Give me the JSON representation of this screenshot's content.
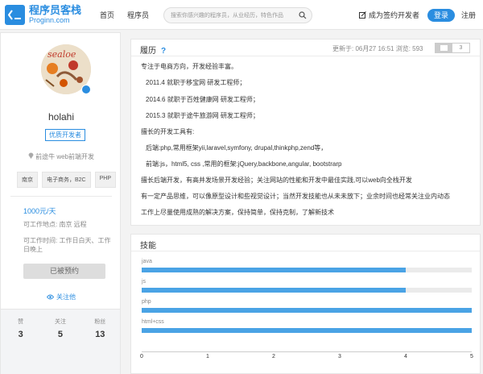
{
  "header": {
    "brand_name": "程序员客栈",
    "brand_domain": "Proginn.com",
    "nav": [
      "首页",
      "程序员"
    ],
    "search_placeholder": "搜索你感兴趣的程序员，从业经历，特色作品",
    "hire_label": "成为签约开发者",
    "login_label": "登录",
    "register_label": "注册"
  },
  "profile": {
    "username": "holahi",
    "badge": "优质开发者",
    "position": "前途牛 web前端开发",
    "tags": [
      "南京",
      "电子商务，B2C",
      "PHP"
    ],
    "price": "1000元/天",
    "location": "可工作地点: 南京 远程",
    "work_time": "可工作时间: 工作日白天、工作日晚上",
    "booked_label": "已被预约",
    "follow_label": "关注他",
    "stats": [
      {
        "label": "赞",
        "value": "3"
      },
      {
        "label": "关注",
        "value": "5"
      },
      {
        "label": "粉丝",
        "value": "13"
      }
    ]
  },
  "resume": {
    "title": "履历",
    "help": "?",
    "updated": "更新于: 06月27 16:51 浏览: 593",
    "page": "3",
    "lines": [
      "专注于电商方向，开发经验丰富。",
      "2011.4 就职于移宝网 研发工程师；",
      "2014.6 就职于百姓健康网 研发工程师；",
      "2015.3 就职于途牛旅游网 研发工程师；",
      "擅长的开发工具有:",
      "后端:php,常用框架yii,laravel,symfony, drupal,thinkphp,zend等，",
      "前端:js，html5, css     ,常用的框架:jQuery,backbone,angular, bootstrarp",
      "擅长后端开发，有高并发场景开发经验；关注网站的性能和开发中最佳实践,可以web向全栈开发",
      "有一定产品思维，可以像原型设计和些视觉设计；当然开发技能也从未未放下；业余时间也经常关注业内动态",
      "工作上尽量使用成熟的解决方案，保持简单，保持克制，了解新技术"
    ]
  },
  "skills": {
    "title": "技能",
    "items": [
      {
        "name": "java",
        "value": 4
      },
      {
        "name": "js",
        "value": 4
      },
      {
        "name": "php",
        "value": 5
      },
      {
        "name": "html+css",
        "value": 5
      }
    ],
    "ticks": [
      "0",
      "1",
      "2",
      "3",
      "4",
      "5"
    ],
    "max": 5
  },
  "colors": {
    "accent": "#2a8de0",
    "bar": "#4aa3e5"
  }
}
